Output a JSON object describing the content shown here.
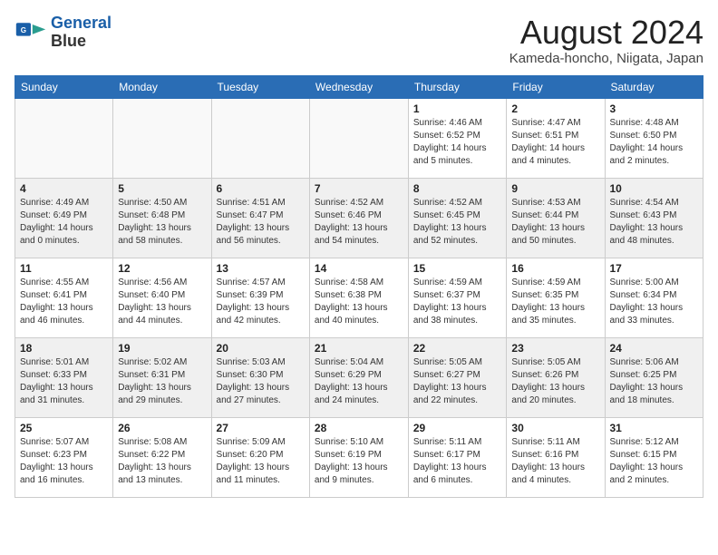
{
  "header": {
    "logo_line1": "General",
    "logo_line2": "Blue",
    "month_year": "August 2024",
    "location": "Kameda-honcho, Niigata, Japan"
  },
  "weekdays": [
    "Sunday",
    "Monday",
    "Tuesday",
    "Wednesday",
    "Thursday",
    "Friday",
    "Saturday"
  ],
  "weeks": [
    [
      {
        "day": "",
        "info": ""
      },
      {
        "day": "",
        "info": ""
      },
      {
        "day": "",
        "info": ""
      },
      {
        "day": "",
        "info": ""
      },
      {
        "day": "1",
        "info": "Sunrise: 4:46 AM\nSunset: 6:52 PM\nDaylight: 14 hours\nand 5 minutes."
      },
      {
        "day": "2",
        "info": "Sunrise: 4:47 AM\nSunset: 6:51 PM\nDaylight: 14 hours\nand 4 minutes."
      },
      {
        "day": "3",
        "info": "Sunrise: 4:48 AM\nSunset: 6:50 PM\nDaylight: 14 hours\nand 2 minutes."
      }
    ],
    [
      {
        "day": "4",
        "info": "Sunrise: 4:49 AM\nSunset: 6:49 PM\nDaylight: 14 hours\nand 0 minutes."
      },
      {
        "day": "5",
        "info": "Sunrise: 4:50 AM\nSunset: 6:48 PM\nDaylight: 13 hours\nand 58 minutes."
      },
      {
        "day": "6",
        "info": "Sunrise: 4:51 AM\nSunset: 6:47 PM\nDaylight: 13 hours\nand 56 minutes."
      },
      {
        "day": "7",
        "info": "Sunrise: 4:52 AM\nSunset: 6:46 PM\nDaylight: 13 hours\nand 54 minutes."
      },
      {
        "day": "8",
        "info": "Sunrise: 4:52 AM\nSunset: 6:45 PM\nDaylight: 13 hours\nand 52 minutes."
      },
      {
        "day": "9",
        "info": "Sunrise: 4:53 AM\nSunset: 6:44 PM\nDaylight: 13 hours\nand 50 minutes."
      },
      {
        "day": "10",
        "info": "Sunrise: 4:54 AM\nSunset: 6:43 PM\nDaylight: 13 hours\nand 48 minutes."
      }
    ],
    [
      {
        "day": "11",
        "info": "Sunrise: 4:55 AM\nSunset: 6:41 PM\nDaylight: 13 hours\nand 46 minutes."
      },
      {
        "day": "12",
        "info": "Sunrise: 4:56 AM\nSunset: 6:40 PM\nDaylight: 13 hours\nand 44 minutes."
      },
      {
        "day": "13",
        "info": "Sunrise: 4:57 AM\nSunset: 6:39 PM\nDaylight: 13 hours\nand 42 minutes."
      },
      {
        "day": "14",
        "info": "Sunrise: 4:58 AM\nSunset: 6:38 PM\nDaylight: 13 hours\nand 40 minutes."
      },
      {
        "day": "15",
        "info": "Sunrise: 4:59 AM\nSunset: 6:37 PM\nDaylight: 13 hours\nand 38 minutes."
      },
      {
        "day": "16",
        "info": "Sunrise: 4:59 AM\nSunset: 6:35 PM\nDaylight: 13 hours\nand 35 minutes."
      },
      {
        "day": "17",
        "info": "Sunrise: 5:00 AM\nSunset: 6:34 PM\nDaylight: 13 hours\nand 33 minutes."
      }
    ],
    [
      {
        "day": "18",
        "info": "Sunrise: 5:01 AM\nSunset: 6:33 PM\nDaylight: 13 hours\nand 31 minutes."
      },
      {
        "day": "19",
        "info": "Sunrise: 5:02 AM\nSunset: 6:31 PM\nDaylight: 13 hours\nand 29 minutes."
      },
      {
        "day": "20",
        "info": "Sunrise: 5:03 AM\nSunset: 6:30 PM\nDaylight: 13 hours\nand 27 minutes."
      },
      {
        "day": "21",
        "info": "Sunrise: 5:04 AM\nSunset: 6:29 PM\nDaylight: 13 hours\nand 24 minutes."
      },
      {
        "day": "22",
        "info": "Sunrise: 5:05 AM\nSunset: 6:27 PM\nDaylight: 13 hours\nand 22 minutes."
      },
      {
        "day": "23",
        "info": "Sunrise: 5:05 AM\nSunset: 6:26 PM\nDaylight: 13 hours\nand 20 minutes."
      },
      {
        "day": "24",
        "info": "Sunrise: 5:06 AM\nSunset: 6:25 PM\nDaylight: 13 hours\nand 18 minutes."
      }
    ],
    [
      {
        "day": "25",
        "info": "Sunrise: 5:07 AM\nSunset: 6:23 PM\nDaylight: 13 hours\nand 16 minutes."
      },
      {
        "day": "26",
        "info": "Sunrise: 5:08 AM\nSunset: 6:22 PM\nDaylight: 13 hours\nand 13 minutes."
      },
      {
        "day": "27",
        "info": "Sunrise: 5:09 AM\nSunset: 6:20 PM\nDaylight: 13 hours\nand 11 minutes."
      },
      {
        "day": "28",
        "info": "Sunrise: 5:10 AM\nSunset: 6:19 PM\nDaylight: 13 hours\nand 9 minutes."
      },
      {
        "day": "29",
        "info": "Sunrise: 5:11 AM\nSunset: 6:17 PM\nDaylight: 13 hours\nand 6 minutes."
      },
      {
        "day": "30",
        "info": "Sunrise: 5:11 AM\nSunset: 6:16 PM\nDaylight: 13 hours\nand 4 minutes."
      },
      {
        "day": "31",
        "info": "Sunrise: 5:12 AM\nSunset: 6:15 PM\nDaylight: 13 hours\nand 2 minutes."
      }
    ]
  ]
}
